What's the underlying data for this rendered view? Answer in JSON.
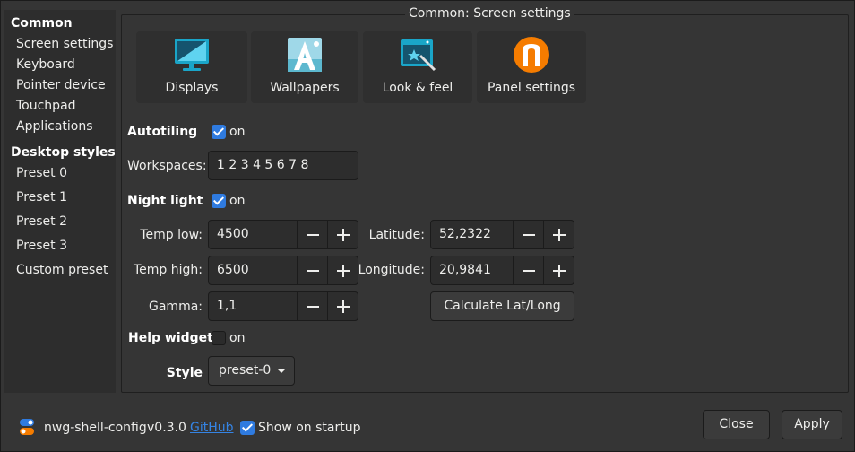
{
  "sidebar": {
    "common_header": "Common",
    "common_items": [
      "Screen settings",
      "Keyboard",
      "Pointer device",
      "Touchpad",
      "Applications"
    ],
    "styles_header": "Desktop styles",
    "style_items": [
      "Preset 0",
      "Preset 1",
      "Preset 2",
      "Preset 3",
      "Custom preset"
    ]
  },
  "frame": {
    "title": "Common: Screen settings"
  },
  "icon_buttons": [
    {
      "label": "Displays",
      "icon": "display-icon"
    },
    {
      "label": "Wallpapers",
      "icon": "wallpaper-icon"
    },
    {
      "label": "Look & feel",
      "icon": "look-and-feel-icon"
    },
    {
      "label": "Panel settings",
      "icon": "panel-settings-icon"
    }
  ],
  "autotiling": {
    "label": "Autotiling",
    "check_label": "on",
    "checked": true
  },
  "workspaces": {
    "label": "Workspaces:",
    "value": "1 2 3 4 5 6 7 8"
  },
  "night_light": {
    "label": "Night light",
    "check_label": "on",
    "checked": true
  },
  "temp_low": {
    "label": "Temp low:",
    "value": "4500"
  },
  "temp_high": {
    "label": "Temp high:",
    "value": "6500"
  },
  "gamma": {
    "label": "Gamma:",
    "value": "1,1"
  },
  "latitude": {
    "label": "Latitude:",
    "value": "52,2322"
  },
  "longitude": {
    "label": "Longitude:",
    "value": "20,9841"
  },
  "calc_button": "Calculate Lat/Long",
  "help_widget": {
    "label": "Help widget",
    "check_label": "on",
    "checked": false
  },
  "style": {
    "label": "Style",
    "value": "preset-0"
  },
  "footer": {
    "app_name": "nwg-shell-config",
    "version": "v0.3.0",
    "link": "GitHub",
    "show_on_startup": "Show on startup",
    "show_on_startup_checked": true,
    "close": "Close",
    "apply": "Apply"
  },
  "colors": {
    "accent": "#2f7be0",
    "link": "#3584e4",
    "display_icon": "#1aa5c8",
    "panel_icon": "#f57c00"
  }
}
